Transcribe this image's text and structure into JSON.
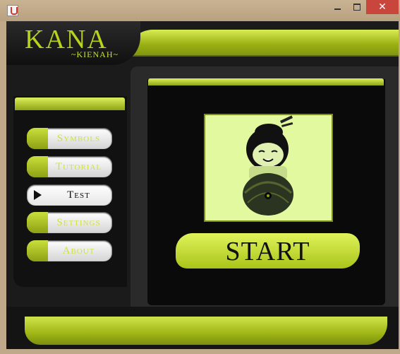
{
  "app": {
    "logo_title": "KANA",
    "logo_subtitle": "~KIENAH~"
  },
  "window": {
    "close_glyph": "✕",
    "icons": [
      "java-app-icon",
      "minimize-icon",
      "maximize-icon",
      "close-icon"
    ]
  },
  "menu": {
    "items": [
      {
        "label": "Symbols",
        "active": false
      },
      {
        "label": "Tutorial",
        "active": false
      },
      {
        "label": "Test",
        "active": true
      },
      {
        "label": "Settings",
        "active": false
      },
      {
        "label": "About",
        "active": false
      }
    ]
  },
  "main": {
    "start_label": "START",
    "mascot": "kokeshi-doll-image"
  },
  "colors": {
    "accent": "#b9d31d",
    "accent_dark": "#8fa415",
    "panel": "#111111",
    "mascot_bg": "#e3f9a0"
  }
}
